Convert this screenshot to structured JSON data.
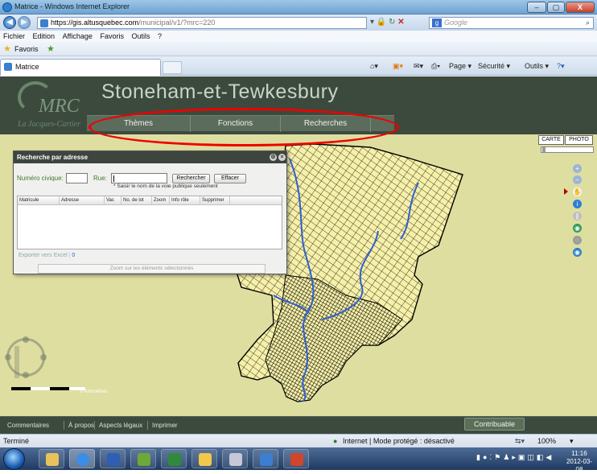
{
  "browser": {
    "window_title": "Matrice - Windows Internet Explorer",
    "window_buttons": [
      "–",
      "▢",
      "X"
    ],
    "url_prefix": "https://gis.",
    "url_domain": "altusquebec.com",
    "url_path": "/municipal/v1/?mrc=220",
    "search_placeholder": "Google",
    "menu": [
      "Fichier",
      "Edition",
      "Affichage",
      "Favoris",
      "Outils",
      "?"
    ],
    "favorites_label": "Favoris",
    "tab_label": "Matrice",
    "command_bar": [
      "Page ▾",
      "Sécurité ▾",
      "Outils ▾"
    ],
    "status_left": "Terminé",
    "status_zone": "Internet | Mode protégé : désactivé",
    "zoom_level": "100%"
  },
  "app": {
    "logo_text": "MRC",
    "logo_subtitle": "La Jacques-Cartier",
    "title": "Stoneham-et-Tewkesbury",
    "nav": [
      "Thèmes",
      "Fonctions",
      "Recherches"
    ],
    "map_toggle": [
      "CARTE",
      "PHOTO"
    ],
    "scale_label": "0 Kilomètres",
    "footer_links": [
      "Commentaires",
      "À propos",
      "Aspects légaux",
      "Imprimer"
    ],
    "contrib_button": "Contribuable"
  },
  "dialog": {
    "title": "Recherche par adresse",
    "label_civic": "Numéro civique:",
    "label_street": "Rue:",
    "civic_value": "",
    "street_value": "",
    "search_button": "Rechercher",
    "clear_button": "Effacer",
    "hint": "* Saisir le nom de la voie publique seulement",
    "columns": [
      "Matricule",
      "Adresse",
      "Vac",
      "No. de lot",
      "Zoom",
      "Info rôle",
      "Supprimer"
    ],
    "export_label": "Exporter vers Excel",
    "export_count": "0",
    "zoom_selected": "Zoom sur les éléments sélectionnés"
  },
  "taskbar": {
    "clock_time": "11:16",
    "clock_date": "2012-03-08"
  },
  "colors": {
    "app_header": "#3c4a3e",
    "map_background": "#dedea0",
    "parcels": "#f6f0a8",
    "highlight_oval": "#e00000",
    "river": "#2f5fd0"
  }
}
